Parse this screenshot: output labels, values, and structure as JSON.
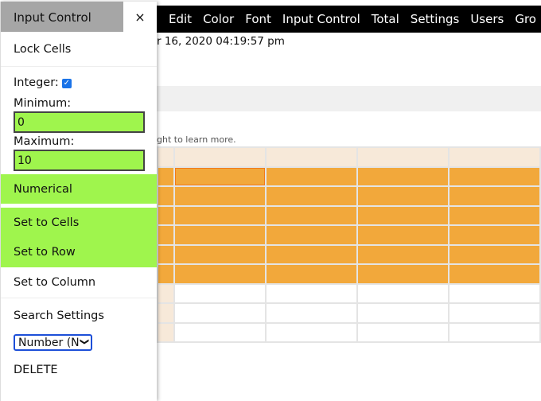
{
  "menu": [
    "Edit",
    "Color",
    "Font",
    "Input Control",
    "Total",
    "Settings",
    "Users",
    "Gro"
  ],
  "date_text": "r 16, 2020 04:19:57 pm",
  "hint_text": "ght to learn more.",
  "panel": {
    "title": "Input Control",
    "close": "×",
    "lock_cells": "Lock Cells",
    "integer_label": "Integer:",
    "integer_checked": true,
    "minimum_label": "Minimum:",
    "minimum_value": "0",
    "maximum_label": "Maximum:",
    "maximum_value": "10",
    "numerical": "Numerical",
    "set_cells": "Set to Cells",
    "set_row": "Set to Row",
    "set_column": "Set to Column",
    "search_settings": "Search Settings",
    "search_type": "Number (N",
    "delete": "DELETE"
  },
  "colors": {
    "green": "#9ff54d",
    "orange": "#f2a83b",
    "menubar": "#000000"
  }
}
